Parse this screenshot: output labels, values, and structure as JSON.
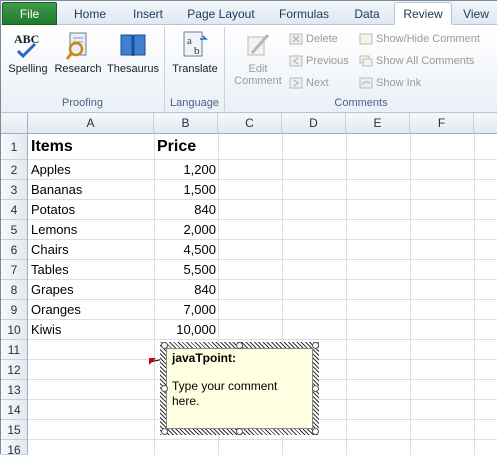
{
  "tabs": [
    "File",
    "Home",
    "Insert",
    "Page Layout",
    "Formulas",
    "Data",
    "Review",
    "View"
  ],
  "active_tab": "Review",
  "ribbon": {
    "proofing": {
      "label": "Proofing",
      "spelling": "Spelling",
      "research": "Research",
      "thesaurus": "Thesaurus",
      "spelling_icon_text": "ABC"
    },
    "language": {
      "label": "Language",
      "translate": "Translate"
    },
    "comments": {
      "label": "Comments",
      "edit_comment_line1": "Edit",
      "edit_comment_line2": "Comment",
      "delete": "Delete",
      "previous": "Previous",
      "next": "Next",
      "show_hide": "Show/Hide Comment",
      "show_all": "Show All Comments",
      "show_ink": "Show Ink"
    }
  },
  "columns": [
    "A",
    "B",
    "C",
    "D",
    "E",
    "F"
  ],
  "rows": [
    "1",
    "2",
    "3",
    "4",
    "5",
    "6",
    "7",
    "8",
    "9",
    "10",
    "11",
    "12",
    "13",
    "14",
    "15",
    "16"
  ],
  "table": {
    "headers": [
      "Items",
      "Price"
    ],
    "data": [
      [
        "Apples",
        "1,200"
      ],
      [
        "Bananas",
        "1,500"
      ],
      [
        "Potatos",
        "840"
      ],
      [
        "Lemons",
        "2,000"
      ],
      [
        "Chairs",
        "4,500"
      ],
      [
        "Tables",
        "5,500"
      ],
      [
        "Grapes",
        "840"
      ],
      [
        "Oranges",
        "7,000"
      ],
      [
        "Kiwis",
        "10,000"
      ]
    ]
  },
  "comment": {
    "author": "javaTpoint:",
    "text": "Type your comment here."
  }
}
